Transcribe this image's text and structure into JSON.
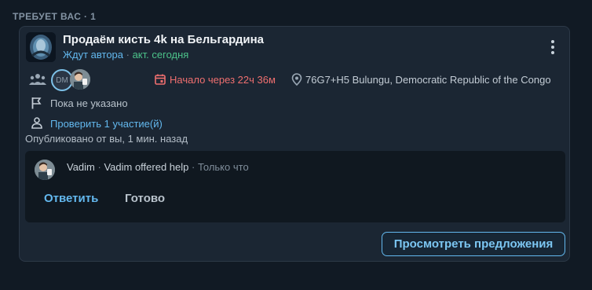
{
  "section": {
    "label": "ТРЕБУЕТ ВАС · 1"
  },
  "card": {
    "title": "Продаём кисть 4k на Бельгардина",
    "status_waiting": "Ждут автора",
    "status_separator": " · ",
    "status_active": "акт. сегодня",
    "participants": {
      "initials": "DM"
    },
    "start_text": "Начало через 22ч 36м",
    "location": "76G7+H5 Bulungu, Democratic Republic of the Congo",
    "flag_text": "Пока не указано",
    "verify_link": "Проверить 1 участие(й)",
    "published": "Опубликовано от вы, 1 мин. назад",
    "comment": {
      "author": "Vadim",
      "separator": " · ",
      "action": "Vadim offered help",
      "time": "Только что"
    },
    "reply_label": "Ответить",
    "done_label": "Готово",
    "offers_button": "Просмотреть предложения"
  },
  "colors": {
    "accent": "#63b8ee",
    "danger": "#ef6f6f",
    "active": "#4cc38a",
    "background": "#111a24",
    "card": "#1b2633"
  },
  "icons": [
    "group-icon",
    "calendar-icon",
    "map-pin-icon",
    "flag-icon",
    "person-icon",
    "more-vert-icon"
  ]
}
